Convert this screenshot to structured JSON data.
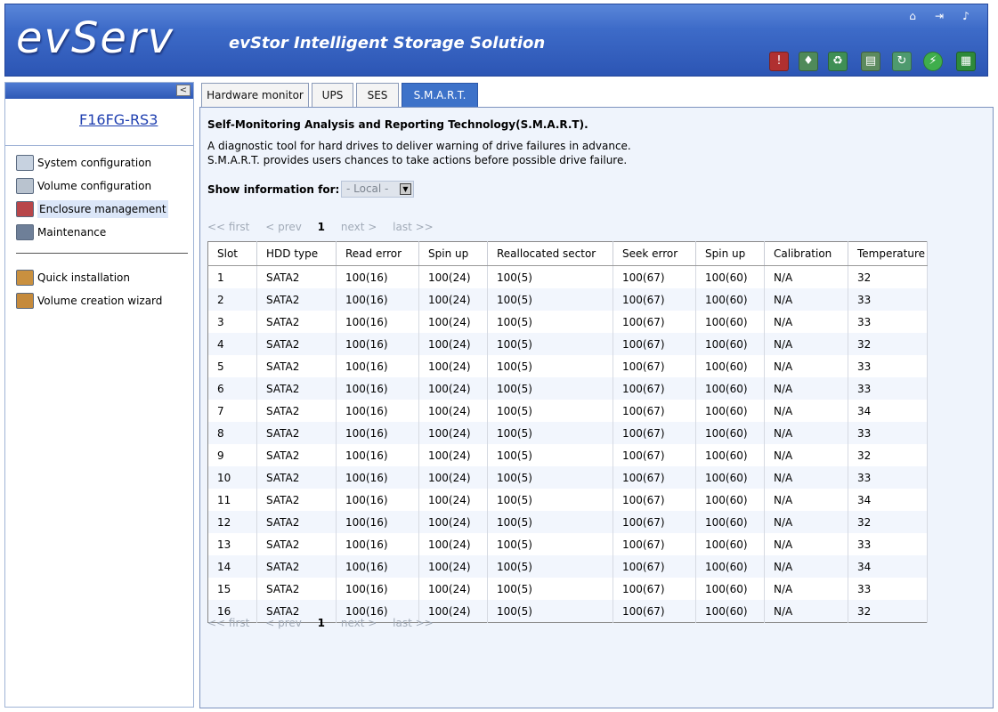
{
  "header": {
    "logo": "evServ",
    "tagline": "evStor Intelligent Storage Solution",
    "top_icons": [
      "home-icon",
      "logout-icon",
      "sound-icon"
    ],
    "toolbar_icons": [
      "disk-alert-icon",
      "water-icon",
      "recycle-icon",
      "floppy-icon",
      "cycle-icon",
      "power-icon",
      "chip-icon"
    ]
  },
  "sidebar": {
    "collapse": "<",
    "device": "F16FG-RS3",
    "items": [
      {
        "label": "System configuration",
        "icon": "system-config-icon"
      },
      {
        "label": "Volume configuration",
        "icon": "volume-config-icon"
      },
      {
        "label": "Enclosure management",
        "icon": "enclosure-icon"
      },
      {
        "label": "Maintenance",
        "icon": "maintenance-icon"
      }
    ],
    "wizards": [
      {
        "label": "Quick installation",
        "icon": "quick-install-icon"
      },
      {
        "label": "Volume creation wizard",
        "icon": "wizard-icon"
      }
    ]
  },
  "tabs": [
    "Hardware monitor",
    "UPS",
    "SES",
    "S.M.A.R.T."
  ],
  "content": {
    "title": "Self-Monitoring Analysis and Reporting Technology(S.M.A.R.T).",
    "desc1": "A diagnostic tool for hard drives to deliver warning of drive failures in advance.",
    "desc2": "S.M.A.R.T. provides users chances to take actions before possible drive failure.",
    "show_label": "Show information for:",
    "select_value": "- Local -",
    "pager": {
      "first": "<< first",
      "prev": "< prev",
      "page": "1",
      "next": "next >",
      "last": "last >>"
    }
  },
  "table": {
    "headers": [
      "Slot",
      "HDD type",
      "Read error",
      "Spin up",
      "Reallocated sector",
      "Seek error",
      "Spin up",
      "Calibration",
      "Temperature"
    ],
    "rows": [
      [
        "1",
        "SATA2",
        "100(16)",
        "100(24)",
        "100(5)",
        "100(67)",
        "100(60)",
        "N/A",
        "32"
      ],
      [
        "2",
        "SATA2",
        "100(16)",
        "100(24)",
        "100(5)",
        "100(67)",
        "100(60)",
        "N/A",
        "33"
      ],
      [
        "3",
        "SATA2",
        "100(16)",
        "100(24)",
        "100(5)",
        "100(67)",
        "100(60)",
        "N/A",
        "33"
      ],
      [
        "4",
        "SATA2",
        "100(16)",
        "100(24)",
        "100(5)",
        "100(67)",
        "100(60)",
        "N/A",
        "32"
      ],
      [
        "5",
        "SATA2",
        "100(16)",
        "100(24)",
        "100(5)",
        "100(67)",
        "100(60)",
        "N/A",
        "33"
      ],
      [
        "6",
        "SATA2",
        "100(16)",
        "100(24)",
        "100(5)",
        "100(67)",
        "100(60)",
        "N/A",
        "33"
      ],
      [
        "7",
        "SATA2",
        "100(16)",
        "100(24)",
        "100(5)",
        "100(67)",
        "100(60)",
        "N/A",
        "34"
      ],
      [
        "8",
        "SATA2",
        "100(16)",
        "100(24)",
        "100(5)",
        "100(67)",
        "100(60)",
        "N/A",
        "33"
      ],
      [
        "9",
        "SATA2",
        "100(16)",
        "100(24)",
        "100(5)",
        "100(67)",
        "100(60)",
        "N/A",
        "32"
      ],
      [
        "10",
        "SATA2",
        "100(16)",
        "100(24)",
        "100(5)",
        "100(67)",
        "100(60)",
        "N/A",
        "33"
      ],
      [
        "11",
        "SATA2",
        "100(16)",
        "100(24)",
        "100(5)",
        "100(67)",
        "100(60)",
        "N/A",
        "34"
      ],
      [
        "12",
        "SATA2",
        "100(16)",
        "100(24)",
        "100(5)",
        "100(67)",
        "100(60)",
        "N/A",
        "32"
      ],
      [
        "13",
        "SATA2",
        "100(16)",
        "100(24)",
        "100(5)",
        "100(67)",
        "100(60)",
        "N/A",
        "33"
      ],
      [
        "14",
        "SATA2",
        "100(16)",
        "100(24)",
        "100(5)",
        "100(67)",
        "100(60)",
        "N/A",
        "34"
      ],
      [
        "15",
        "SATA2",
        "100(16)",
        "100(24)",
        "100(5)",
        "100(67)",
        "100(60)",
        "N/A",
        "33"
      ],
      [
        "16",
        "SATA2",
        "100(16)",
        "100(24)",
        "100(5)",
        "100(67)",
        "100(60)",
        "N/A",
        "32"
      ]
    ]
  }
}
